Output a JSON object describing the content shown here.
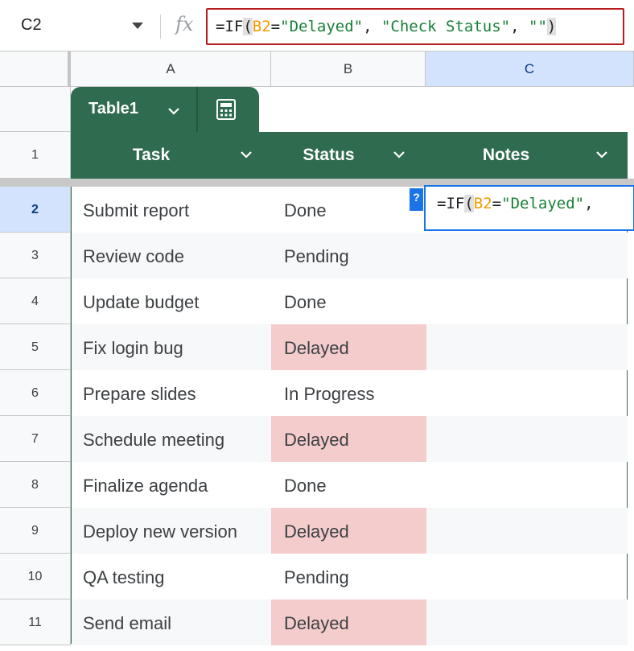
{
  "name_box": {
    "value": "C2"
  },
  "formula_bar": {
    "fx_label": "fx",
    "formula": {
      "func": "=IF",
      "open": "(",
      "ref": "B2",
      "eq_str": "=",
      "str1": "\"Delayed\"",
      "sep1": ", ",
      "str2": "\"Check Status\"",
      "sep2": ", ",
      "str3": "\"\"",
      "close": ")"
    }
  },
  "columns": [
    "A",
    "B",
    "C"
  ],
  "selected_column": "C",
  "table": {
    "name": "Table1",
    "headers": [
      "Task",
      "Status",
      "Notes"
    ],
    "rows": [
      {
        "row": "2",
        "task": "Submit report",
        "status": "Done"
      },
      {
        "row": "3",
        "task": "Review code",
        "status": "Pending"
      },
      {
        "row": "4",
        "task": "Update budget",
        "status": "Done"
      },
      {
        "row": "5",
        "task": "Fix login bug",
        "status": "Delayed"
      },
      {
        "row": "6",
        "task": "Prepare slides",
        "status": "In Progress"
      },
      {
        "row": "7",
        "task": "Schedule meeting",
        "status": "Delayed"
      },
      {
        "row": "8",
        "task": "Finalize agenda",
        "status": "Done"
      },
      {
        "row": "9",
        "task": "Deploy new version",
        "status": "Delayed"
      },
      {
        "row": "10",
        "task": "QA testing",
        "status": "Pending"
      },
      {
        "row": "11",
        "task": "Send email",
        "status": "Delayed"
      }
    ]
  },
  "header_row_number": "1",
  "editing_cell": {
    "badge": "?",
    "text_func": "=IF",
    "text_open": "(",
    "text_ref": "B2",
    "text_eq": "=",
    "text_str": "\"Delayed\"",
    "text_tail": ","
  },
  "colors": {
    "table_header": "#2e6b4f",
    "delayed_fill": "#f4cccc",
    "formula_box_border": "#b71c1c",
    "selection_blue": "#1a73e8"
  }
}
